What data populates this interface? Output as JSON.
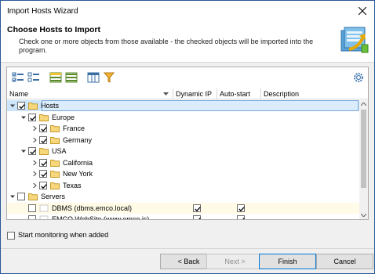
{
  "window": {
    "title": "Import Hosts Wizard"
  },
  "header": {
    "title": "Choose Hosts to Import",
    "description": "Check one or more objects from those available - the checked objects will be imported into the program."
  },
  "columns": [
    "Name",
    "Dynamic IP",
    "Auto-start",
    "Description"
  ],
  "tree": [
    {
      "label": "Hosts",
      "checked": true
    },
    {
      "label": "Europe",
      "checked": true
    },
    {
      "label": "France",
      "checked": true
    },
    {
      "label": "Germany",
      "checked": true
    },
    {
      "label": "USA",
      "checked": true
    },
    {
      "label": "California",
      "checked": true
    },
    {
      "label": "New York",
      "checked": true
    },
    {
      "label": "Texas",
      "checked": true
    },
    {
      "label": "Servers",
      "checked": false
    },
    {
      "label": "DBMS (dbms.emco.local)",
      "checked": false,
      "dynamic_ip": true,
      "auto_start": true
    },
    {
      "label": "EMCO WebSite (www.emco.is)",
      "checked": false,
      "dynamic_ip": true,
      "auto_start": true
    }
  ],
  "options": {
    "start_monitoring_label": "Start monitoring when added",
    "start_monitoring_checked": false
  },
  "buttons": {
    "back": "< Back",
    "next": "Next >",
    "finish": "Finish",
    "cancel": "Cancel"
  }
}
